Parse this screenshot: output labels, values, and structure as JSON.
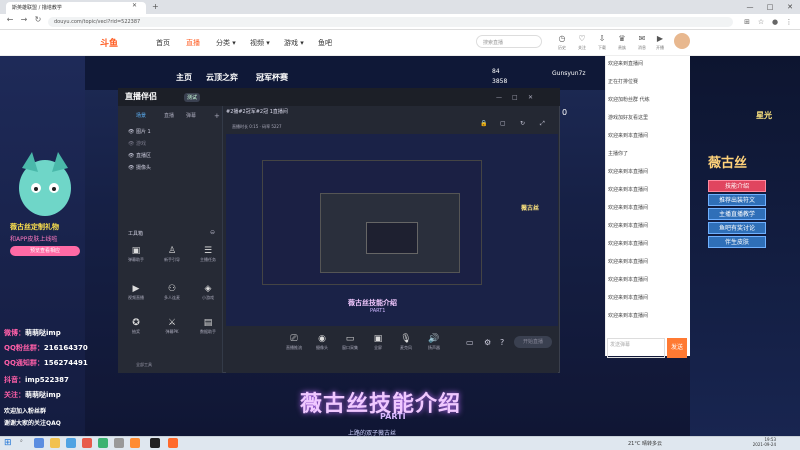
{
  "browser": {
    "tab_title": "斯英雄联盟 / 撸塔教学",
    "url": "douyu.com/topic/vecl?rid=522387",
    "window_controls": [
      "—",
      "□",
      "✕"
    ]
  },
  "site": {
    "logo": "斗鱼",
    "nav": [
      "首页",
      "直播",
      "分类 ▾",
      "视频 ▾",
      "游戏 ▾",
      "鱼吧"
    ],
    "search_placeholder": "搜索直播",
    "header_icons": [
      {
        "icon": "history-icon",
        "label": "历史"
      },
      {
        "icon": "follow-icon",
        "label": "关注"
      },
      {
        "icon": "download-icon",
        "label": "下载"
      },
      {
        "icon": "vip-icon",
        "label": "贵族"
      },
      {
        "icon": "message-icon",
        "label": "消息"
      },
      {
        "icon": "broadcast-icon",
        "label": "开播"
      },
      {
        "icon": "center-icon",
        "label": "个人中心"
      }
    ]
  },
  "stream": {
    "tabs": [
      "主页",
      "云顶之弈",
      "冠军杯赛"
    ],
    "gift_count": "84",
    "hot": "3858",
    "anchor": "Gunsyun7z",
    "weekly_rank": "0"
  },
  "left_panel": {
    "lines": [
      {
        "key": "微博：",
        "value": "萌萌哒imp"
      },
      {
        "key": "QQ粉丝群：",
        "value": "216164370"
      },
      {
        "key": "QQ通知群：",
        "value": "156274491"
      },
      {
        "key": "抖音：",
        "value": "imp522387"
      },
      {
        "key": "关注：",
        "value": "萌萌哒imp"
      }
    ],
    "promo_title": "薇古丝定制礼物",
    "promo_sub": "和APP皮肤上线啦",
    "promo_button": "预览查看相应",
    "bottom_text": [
      "欢迎加入粉丝群",
      "谢谢大家的关注QAQ"
    ]
  },
  "chat": {
    "messages": [
      {
        "user": "",
        "text": "欢迎来到直播间"
      },
      {
        "user": "",
        "text": "正在打排位赛"
      },
      {
        "user": "",
        "text": "欢迎加粉丝群 代练"
      },
      {
        "user": "",
        "text": "游戏加好友看这里"
      },
      {
        "user": "",
        "text": "欢迎来到本直播间"
      },
      {
        "user": "",
        "text": "主播你了"
      },
      {
        "user": "",
        "text": "欢迎来到本直播间"
      },
      {
        "user": "",
        "text": "欢迎来到本直播间"
      },
      {
        "user": "",
        "text": "欢迎来到本直播间"
      },
      {
        "user": "",
        "text": "欢迎来到本直播间"
      },
      {
        "user": "",
        "text": "欢迎来到本直播间"
      },
      {
        "user": "",
        "text": "欢迎来到本直播间"
      },
      {
        "user": "",
        "text": "欢迎来到本直播间"
      },
      {
        "user": "",
        "text": "欢迎来到本直播间"
      },
      {
        "user": "",
        "text": "欢迎来到本直播间"
      }
    ],
    "input_placeholder": "发送弹幕",
    "send_label": "发送"
  },
  "right_banner": {
    "title": "薇古丝",
    "buttons": [
      "技能介绍",
      "推荐出装符文",
      "主播直播教学",
      "鱼吧有奖讨论",
      "伴生皮肤"
    ],
    "corner": "星光"
  },
  "obs": {
    "logo": "直播伴侣",
    "badge": "测试",
    "tabs": [
      "场景",
      "直播",
      "弹幕"
    ],
    "scenes": [
      "图片 1",
      "游戏",
      "直播区",
      "摄像头"
    ],
    "tools_title": "工具箱",
    "tools": [
      {
        "icon": "danmu-icon",
        "label": "弹幕助手"
      },
      {
        "icon": "fans-icon",
        "label": "新手引导"
      },
      {
        "icon": "task-icon",
        "label": "主播任务"
      },
      {
        "icon": "video-icon",
        "label": "视频直播"
      },
      {
        "icon": "multi-icon",
        "label": "多人连麦"
      },
      {
        "icon": "game-icon",
        "label": "小游戏"
      },
      {
        "icon": "lottery-icon",
        "label": "抽奖"
      },
      {
        "icon": "pk-icon",
        "label": "弹幕PK"
      },
      {
        "icon": "data-icon",
        "label": "数据助手"
      }
    ],
    "footer": "全部工具",
    "header": "#2播#2冠军#2冠 1直播间",
    "stats": "直播时长 0:15 · 码率 5227",
    "controls": [
      {
        "icon": "stream-icon",
        "label": "直播推流"
      },
      {
        "icon": "camera-icon",
        "label": "摄像头"
      },
      {
        "icon": "window-icon",
        "label": "窗口采集"
      },
      {
        "icon": "screen-icon",
        "label": "全屏"
      },
      {
        "icon": "mic-icon",
        "label": "麦克风"
      },
      {
        "icon": "speaker-icon",
        "label": "扬声器"
      }
    ],
    "start_button": "开始直播",
    "preview_title": "薇古丝技能介绍",
    "preview_part": "PART1",
    "preview_brand": "薇古丝"
  },
  "bottom": {
    "title": "薇古丝技能介绍",
    "part": "PARTI",
    "subtitle": "上路的双子薇古丝"
  },
  "taskbar": {
    "search": "在这里输入你要搜索的内容",
    "tray": "21°C 晴转多云",
    "time": "19:53",
    "date": "2021-09-24"
  }
}
